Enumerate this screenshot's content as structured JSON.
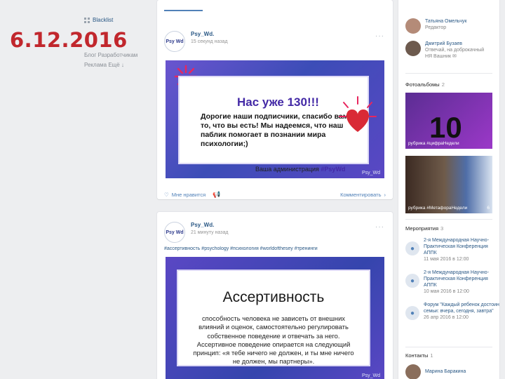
{
  "overlay": {
    "date": "6.12.2016"
  },
  "left_menu": {
    "items": [
      {
        "label": "Blacklist"
      },
      {
        "label": "Блог   Разработчикам"
      },
      {
        "label": "Реклама   Ещё ↓"
      }
    ]
  },
  "post1": {
    "author": "Psy_Wd.",
    "time": "15 секунд назад",
    "more": "···",
    "avatar_text": "Psy Wd",
    "banner": {
      "headline": "Нас уже 130!!!",
      "body": "Дорогие наши подписчики, спасибо вам за то, что вы есть! Мы надеемся, что наш паблик помогает в познании мира психологии;)",
      "sign_prefix": "Ваша администрация",
      "sign_tag": "#PsyWd",
      "brand": "Psy_Wd"
    },
    "like_label": "Мне нравится",
    "comment_label": "Комментировать"
  },
  "post2": {
    "author": "Psy_Wd.",
    "time": "21 минуту назад",
    "more": "···",
    "avatar_text": "Psy Wd",
    "tags": "#ассертивность #psychology #психология #worldofthesey #тренинги",
    "banner": {
      "title": "Ассертивность",
      "body": "способность человека не зависеть от внешних влияний и оценок, самостоятельно регулировать собственное поведение и отвечать за него. Ассертивное поведение опирается на следующий принцип: «я тебе ничего не должен, и ты мне ничего не должен, мы партнеры».",
      "brand": "Psy_Wd"
    }
  },
  "right": {
    "people": [
      {
        "name": "Татьяна Омельчук",
        "desc": "Редактор"
      },
      {
        "name": "Дмитрий Бузаев",
        "desc": "Отвечай, на доброкачный НЯ Вашник ✉"
      }
    ],
    "albums_title": "Фотоальбомы",
    "albums_count": "2",
    "albums": [
      {
        "caption": "рубрика #цифраНедели",
        "big": "10",
        "count": ""
      },
      {
        "caption": "рубрика #МетафораНедели",
        "count": "6"
      }
    ],
    "events_title": "Мероприятия",
    "events_count": "3",
    "events": [
      {
        "title": "2-я Международная Научно-Практическая Конференция АППК",
        "date": "11 мая 2016 в 12:00"
      },
      {
        "title": "2-я Международная Научно-Практическая Конференция АППК",
        "date": "10 мая 2016 в 12:00"
      },
      {
        "title": "Форум \"Каждый ребенок достоин семьи: вчера, сегодня, завтра\"",
        "date": "26 апр 2016 в 12:00"
      }
    ],
    "contacts_title": "Контакты",
    "contacts_count": "1",
    "contact_name": "Марина Баракина"
  },
  "colors": {
    "accent": "#5181b8",
    "link": "#2a5885",
    "date_red": "#c1272d",
    "banner_purple": "#4329a6"
  }
}
